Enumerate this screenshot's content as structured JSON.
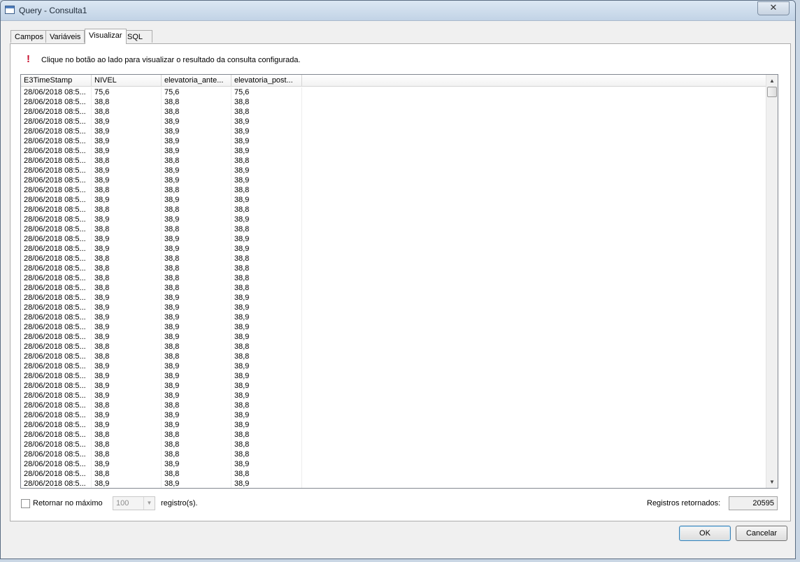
{
  "window": {
    "title": "Query - Consulta1",
    "close_glyph": "✕"
  },
  "tabs": [
    {
      "label": "Campos",
      "active": false
    },
    {
      "label": "Variáveis",
      "active": false
    },
    {
      "label": "Visualizar",
      "active": true
    },
    {
      "label": "SQL",
      "active": false
    }
  ],
  "info": {
    "icon": "exclamation-icon",
    "text": "Clique no botão ao lado para visualizar o resultado da consulta configurada."
  },
  "grid": {
    "columns": [
      "E3TimeStamp",
      "NIVEL",
      "elevatoria_ante...",
      "elevatoria_post..."
    ],
    "rows": [
      [
        "28/06/2018 08:5...",
        "75,6",
        "75,6",
        "75,6"
      ],
      [
        "28/06/2018 08:5...",
        "38,8",
        "38,8",
        "38,8"
      ],
      [
        "28/06/2018 08:5...",
        "38,8",
        "38,8",
        "38,8"
      ],
      [
        "28/06/2018 08:5...",
        "38,9",
        "38,9",
        "38,9"
      ],
      [
        "28/06/2018 08:5...",
        "38,9",
        "38,9",
        "38,9"
      ],
      [
        "28/06/2018 08:5...",
        "38,9",
        "38,9",
        "38,9"
      ],
      [
        "28/06/2018 08:5...",
        "38,9",
        "38,9",
        "38,9"
      ],
      [
        "28/06/2018 08:5...",
        "38,8",
        "38,8",
        "38,8"
      ],
      [
        "28/06/2018 08:5...",
        "38,9",
        "38,9",
        "38,9"
      ],
      [
        "28/06/2018 08:5...",
        "38,9",
        "38,9",
        "38,9"
      ],
      [
        "28/06/2018 08:5...",
        "38,8",
        "38,8",
        "38,8"
      ],
      [
        "28/06/2018 08:5...",
        "38,9",
        "38,9",
        "38,9"
      ],
      [
        "28/06/2018 08:5...",
        "38,8",
        "38,8",
        "38,8"
      ],
      [
        "28/06/2018 08:5...",
        "38,9",
        "38,9",
        "38,9"
      ],
      [
        "28/06/2018 08:5...",
        "38,8",
        "38,8",
        "38,8"
      ],
      [
        "28/06/2018 08:5...",
        "38,9",
        "38,9",
        "38,9"
      ],
      [
        "28/06/2018 08:5...",
        "38,9",
        "38,9",
        "38,9"
      ],
      [
        "28/06/2018 08:5...",
        "38,8",
        "38,8",
        "38,8"
      ],
      [
        "28/06/2018 08:5...",
        "38,8",
        "38,8",
        "38,8"
      ],
      [
        "28/06/2018 08:5...",
        "38,8",
        "38,8",
        "38,8"
      ],
      [
        "28/06/2018 08:5...",
        "38,8",
        "38,8",
        "38,8"
      ],
      [
        "28/06/2018 08:5...",
        "38,9",
        "38,9",
        "38,9"
      ],
      [
        "28/06/2018 08:5...",
        "38,9",
        "38,9",
        "38,9"
      ],
      [
        "28/06/2018 08:5...",
        "38,9",
        "38,9",
        "38,9"
      ],
      [
        "28/06/2018 08:5...",
        "38,9",
        "38,9",
        "38,9"
      ],
      [
        "28/06/2018 08:5...",
        "38,9",
        "38,9",
        "38,9"
      ],
      [
        "28/06/2018 08:5...",
        "38,8",
        "38,8",
        "38,8"
      ],
      [
        "28/06/2018 08:5...",
        "38,8",
        "38,8",
        "38,8"
      ],
      [
        "28/06/2018 08:5...",
        "38,9",
        "38,9",
        "38,9"
      ],
      [
        "28/06/2018 08:5...",
        "38,9",
        "38,9",
        "38,9"
      ],
      [
        "28/06/2018 08:5...",
        "38,9",
        "38,9",
        "38,9"
      ],
      [
        "28/06/2018 08:5...",
        "38,9",
        "38,9",
        "38,9"
      ],
      [
        "28/06/2018 08:5...",
        "38,8",
        "38,8",
        "38,8"
      ],
      [
        "28/06/2018 08:5...",
        "38,9",
        "38,9",
        "38,9"
      ],
      [
        "28/06/2018 08:5...",
        "38,9",
        "38,9",
        "38,9"
      ],
      [
        "28/06/2018 08:5...",
        "38,8",
        "38,8",
        "38,8"
      ],
      [
        "28/06/2018 08:5...",
        "38,8",
        "38,8",
        "38,8"
      ],
      [
        "28/06/2018 08:5...",
        "38,8",
        "38,8",
        "38,8"
      ],
      [
        "28/06/2018 08:5...",
        "38,9",
        "38,9",
        "38,9"
      ],
      [
        "28/06/2018 08:5...",
        "38,8",
        "38,8",
        "38,8"
      ],
      [
        "28/06/2018 08:5...",
        "38,9",
        "38,9",
        "38,9"
      ]
    ]
  },
  "footer": {
    "checkbox_label": "Retornar no máximo",
    "checkbox_checked": false,
    "max_value": "100",
    "registros_label": "registro(s).",
    "returned_label": "Registros retornados:",
    "returned_value": "20595"
  },
  "buttons": {
    "ok": "OK",
    "cancel": "Cancelar"
  }
}
